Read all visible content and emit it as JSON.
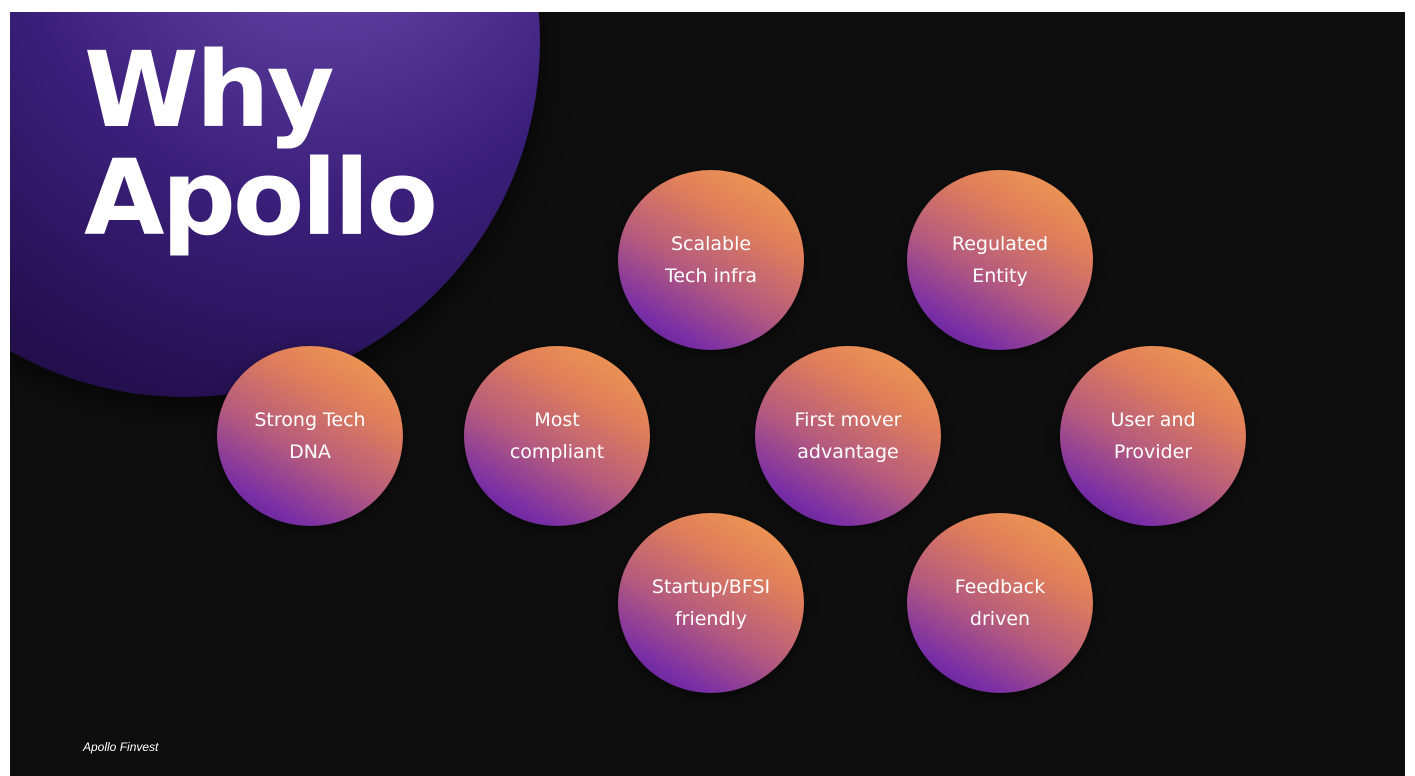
{
  "slide": {
    "title_line1": "Why",
    "title_line2": "Apollo",
    "footer": "Apollo Finvest",
    "colors": {
      "background": "#0e0e0e",
      "accent_purple": "#3a1f7a",
      "bubble_gradient_start": "#f4a24f",
      "bubble_gradient_end": "#4e178f",
      "text": "#ffffff"
    }
  },
  "reasons": [
    {
      "label": "Scalable\nTech infra"
    },
    {
      "label": "Regulated\nEntity"
    },
    {
      "label": "Strong Tech\nDNA"
    },
    {
      "label": "Most\ncompliant"
    },
    {
      "label": "First mover\nadvantage"
    },
    {
      "label": "User and\nProvider"
    },
    {
      "label": "Startup/BFSI\nfriendly"
    },
    {
      "label": "Feedback\ndriven"
    }
  ]
}
